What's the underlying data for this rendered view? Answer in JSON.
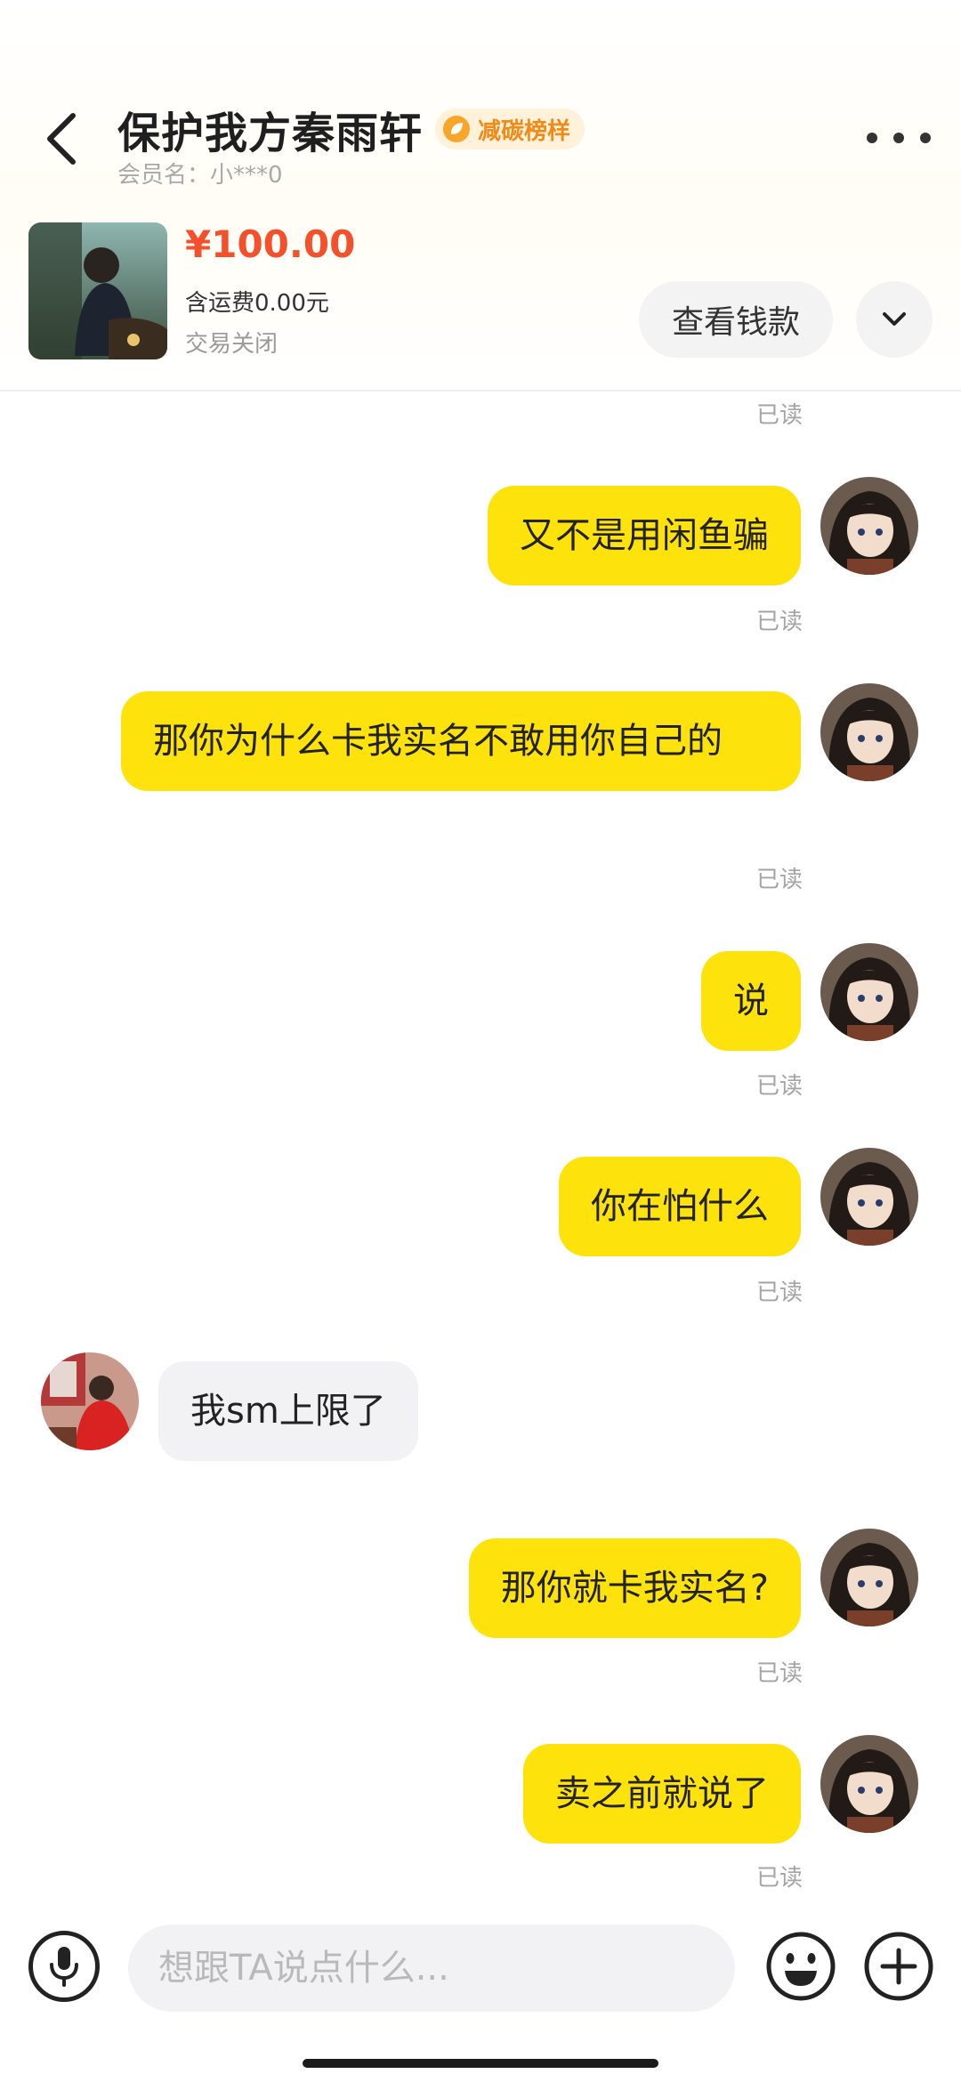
{
  "header": {
    "title": "保护我方秦雨轩",
    "badge": "减碳榜样",
    "member": "会员名：小***0",
    "icons": {
      "back": "chevron-left-icon",
      "more": "more-dots-icon",
      "badge": "leaf-badge-icon"
    }
  },
  "product": {
    "price": "¥100.00",
    "shipping": "含运费0.00元",
    "status": "交易关闭",
    "view_button": "查看钱款",
    "price_color": "#f4502c"
  },
  "chat": {
    "read_label": "已读",
    "messages": [
      {
        "side": "right",
        "text": "又不是用闲鱼骗",
        "read": "已读"
      },
      {
        "side": "right",
        "text": "那你为什么卡我实名不敢用你自己的",
        "read": "已读"
      },
      {
        "side": "right",
        "text": "说",
        "read": "已读"
      },
      {
        "side": "right",
        "text": "你在怕什么",
        "read": "已读"
      },
      {
        "side": "left",
        "text": "我sm上限了"
      },
      {
        "side": "right",
        "text": "那你就卡我实名?",
        "read": "已读"
      },
      {
        "side": "right",
        "text": "卖之前就说了",
        "read": "已读"
      }
    ],
    "bubble_color": "#fde20b"
  },
  "composer": {
    "placeholder": "想跟TA说点什么...",
    "icons": {
      "voice": "microphone-icon",
      "emoji": "emoji-icon",
      "add": "plus-icon"
    }
  }
}
